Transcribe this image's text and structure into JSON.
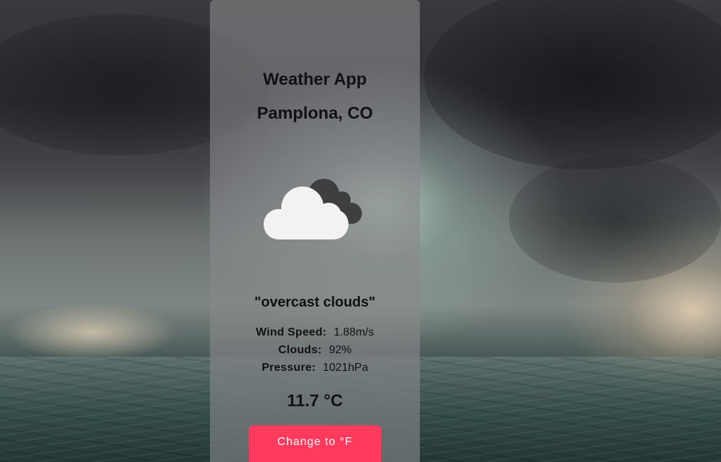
{
  "app": {
    "title": "Weather App"
  },
  "location": {
    "city": "Pamplona, CO"
  },
  "weather": {
    "icon": "overcast-clouds-icon",
    "description": "\"overcast clouds\"",
    "temperature": "11.7 °C"
  },
  "details": {
    "wind_label": "Wind Speed:",
    "wind_value": "1.88m/s",
    "clouds_label": "Clouds:",
    "clouds_value": "92%",
    "pressure_label": "Pressure:",
    "pressure_value": "1021hPa"
  },
  "actions": {
    "toggle_unit_label": "Change to °F"
  },
  "colors": {
    "button": "#ff3a5c",
    "card": "rgba(135,135,138,0.62)"
  }
}
